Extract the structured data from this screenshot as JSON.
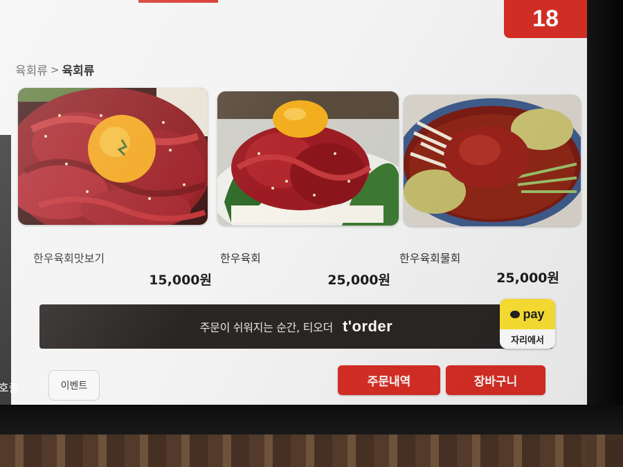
{
  "header": {
    "table_number": "18"
  },
  "breadcrumb": {
    "parent": "육회류",
    "separator": ">",
    "current": "육회류"
  },
  "menu_items": [
    {
      "name": "한우육회맛보기",
      "price": "15,000원"
    },
    {
      "name": "한우육회",
      "price": "25,000원"
    },
    {
      "name": "한우육회물회",
      "price": "25,000원"
    }
  ],
  "banner": {
    "text": "주문이 쉬워지는 순간, 티오더",
    "brand": "t'order"
  },
  "pay_badge": {
    "label": "pay",
    "sub": "자리에서"
  },
  "side": {
    "partial_label": "호출"
  },
  "footer": {
    "event_label": "이벤트",
    "order_history_label": "주문내역",
    "cart_label": "장바구니"
  },
  "colors": {
    "accent": "#d62e25",
    "banner_bg": "#2a2624",
    "pay_yellow": "#fde233"
  }
}
